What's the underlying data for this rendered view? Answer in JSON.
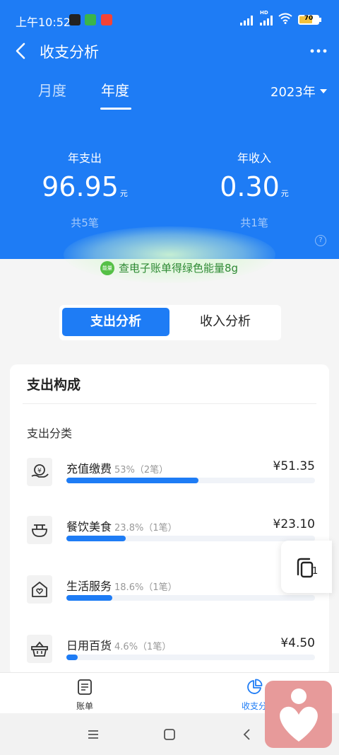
{
  "status": {
    "time": "上午10:52",
    "battery": "70",
    "network_badge": "HD"
  },
  "nav": {
    "title": "收支分析"
  },
  "period_tabs": {
    "month": "月度",
    "year": "年度"
  },
  "year_select": {
    "value": "2023年"
  },
  "summary": {
    "expense_label": "年支出",
    "expense_value": "96.95",
    "expense_unit": "元",
    "expense_count": "共5笔",
    "income_label": "年收入",
    "income_value": "0.30",
    "income_unit": "元",
    "income_count": "共1笔"
  },
  "energy": {
    "badge": "能量",
    "text": "查电子账单得绿色能量8g"
  },
  "segment": {
    "expense": "支出分析",
    "income": "收入分析"
  },
  "card": {
    "title": "支出构成",
    "subtitle": "支出分类"
  },
  "categories": [
    {
      "name": "充值缴费",
      "meta": "53%（2笔）",
      "amount": "¥51.35",
      "icon": "recharge-icon",
      "share": 0.53
    },
    {
      "name": "餐饮美食",
      "meta": "23.8%（1笔）",
      "amount": "¥23.10",
      "icon": "dining-bowl-icon",
      "share": 0.238
    },
    {
      "name": "生活服务",
      "meta": "18.6%（1笔）",
      "amount": "¥",
      "icon": "home-heart-icon",
      "share": 0.186
    },
    {
      "name": "日用百货",
      "meta": "4.6%（1笔）",
      "amount": "¥4.50",
      "icon": "basket-icon",
      "share": 0.046
    }
  ],
  "float_button": {
    "count": "1"
  },
  "tabbar": {
    "bill": "账单",
    "analysis": "收支分"
  },
  "colors": {
    "primary": "#1e7cf5",
    "energy_green": "#55c046",
    "widget_pink": "#e79a9a"
  }
}
